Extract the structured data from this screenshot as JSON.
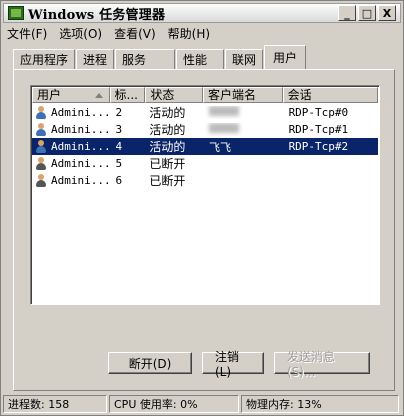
{
  "window": {
    "title": "Windows 任务管理器",
    "buttons": [
      "_",
      "□",
      "X"
    ]
  },
  "menu": [
    "文件(F)",
    "选项(O)",
    "查看(V)",
    "帮助(H)"
  ],
  "tabs": [
    {
      "label": "应用程序"
    },
    {
      "label": "进程"
    },
    {
      "label": "服务"
    },
    {
      "label": "性能"
    },
    {
      "label": "联网"
    },
    {
      "label": "用户",
      "active": true
    }
  ],
  "table": {
    "columns": [
      "用户",
      "标...",
      "状态",
      "客户端名",
      "会话"
    ],
    "rows": [
      {
        "user": "Admini...",
        "id": "4",
        "state": "活动的",
        "client": "飞飞",
        "session": "RDP-Tcp#2",
        "selected": true,
        "disconnected": false
      },
      {
        "user": "Admini...",
        "id": "5",
        "state": "已断开",
        "client": "",
        "session": "",
        "selected": false,
        "disconnected": true
      },
      {
        "user": "Admini...",
        "id": "6",
        "state": "已断开",
        "client": "",
        "session": "",
        "selected": false,
        "disconnected": true
      },
      {
        "user": "Admini...",
        "id": "2",
        "state": "活动的",
        "client": "",
        "session": "RDP-Tcp#0",
        "selected": false,
        "disconnected": false
      },
      {
        "user": "Admini...",
        "id": "3",
        "state": "活动的",
        "client": "",
        "session": "RDP-Tcp#1",
        "selected": false,
        "disconnected": false
      }
    ]
  },
  "actions": {
    "disconnect": "断开(D)",
    "logoff": "注销(L)",
    "send_message": "发送消息(S)..."
  },
  "status": {
    "processes": "进程数: 158",
    "cpu": "CPU 使用率: 0%",
    "memory": "物理内存: 13%"
  }
}
